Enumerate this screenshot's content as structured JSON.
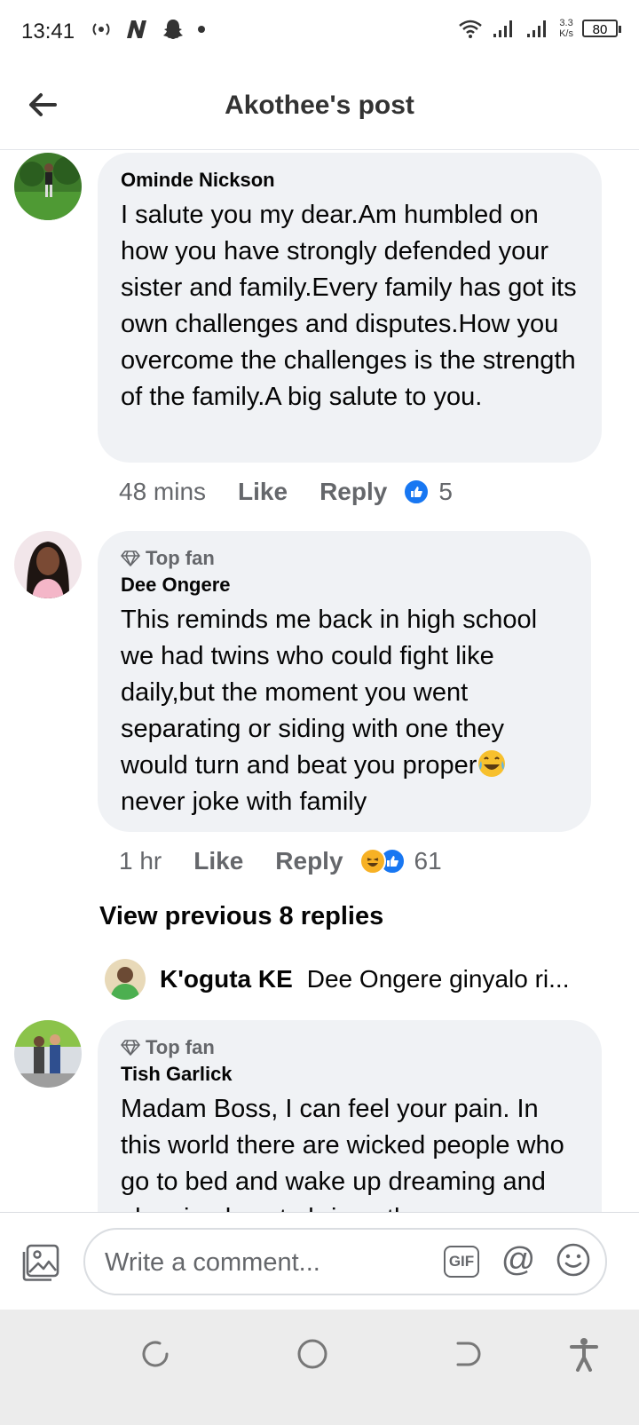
{
  "status_bar": {
    "time": "13:41",
    "speed_top": "3.3",
    "speed_bottom": "K/s",
    "battery": "80"
  },
  "header": {
    "title": "Akothee's post"
  },
  "comments": [
    {
      "name": "Ominde Nickson",
      "text": "I salute you my dear.Am humbled on how you have strongly defended your sister and family.Every family has got its own challenges and disputes.How you overcome the challenges is the strength of the family.A big salute to you.",
      "time": "48 mins",
      "like_label": "Like",
      "reply_label": "Reply",
      "reaction_count": "5"
    },
    {
      "badge": "Top fan",
      "name": "Dee Ongere",
      "text_before_emoji": "This reminds me back in high school we had twins who could fight like daily,but the moment you went separating or siding with one they would turn and beat you proper",
      "text_after_emoji": "never joke with family",
      "time": "1 hr",
      "like_label": "Like",
      "reply_label": "Reply",
      "reaction_count": "61"
    },
    {
      "badge": "Top fan",
      "name": "Tish Garlick",
      "text": "Madam Boss, I can feel your pain. In this world there are wicked people who go to bed and wake up dreaming and planning how to bring other"
    }
  ],
  "view_previous": "View previous 8 replies",
  "reply_preview": {
    "name": "K'oguta KE",
    "text": "Dee Ongere ginyalo ri..."
  },
  "composer": {
    "placeholder": "Write a comment...",
    "gif_label": "GIF",
    "at_label": "@"
  },
  "colors": {
    "bubble": "#f0f2f5",
    "like_blue": "#1877f2",
    "secondary_text": "#65676b"
  }
}
